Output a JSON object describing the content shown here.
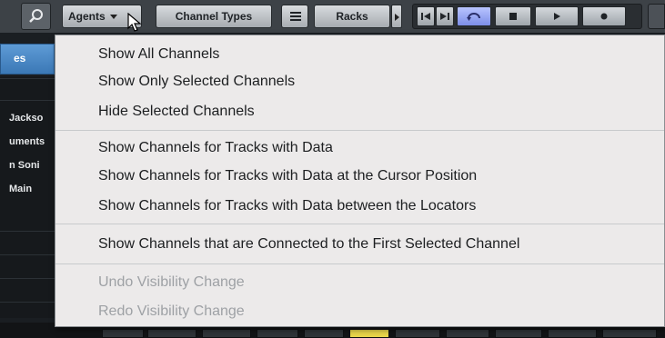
{
  "toolbar": {
    "search_icon": "search-icon",
    "agents_label": "Agents",
    "channel_types_label": "Channel Types",
    "racks_label": "Racks",
    "transport": {
      "buttons": [
        "go-to-start-icon",
        "go-to-end-icon",
        "cycle-icon",
        "stop-icon",
        "play-icon",
        "record-icon"
      ],
      "cycle_active_color": "#8a9bf0"
    }
  },
  "left_panel": {
    "tab_label": "es",
    "channels": [
      "Jackso",
      "uments",
      "n Soni",
      "Main"
    ]
  },
  "menu": {
    "groups": [
      {
        "items": [
          {
            "label": "Show All Channels",
            "enabled": true
          },
          {
            "label": "Show Only Selected Channels",
            "enabled": true
          },
          {
            "label": "Hide Selected Channels",
            "enabled": true
          }
        ]
      },
      {
        "items": [
          {
            "label": "Show Channels for Tracks with Data",
            "enabled": true
          },
          {
            "label": "Show Channels for Tracks with Data at the Cursor Position",
            "enabled": true
          },
          {
            "label": "Show Channels for Tracks with Data between the Locators",
            "enabled": true
          }
        ]
      },
      {
        "items": [
          {
            "label": "Show Channels that are Connected to the First Selected Channel",
            "enabled": true
          }
        ]
      },
      {
        "items": [
          {
            "label": "Undo Visibility Change",
            "enabled": false
          },
          {
            "label": "Redo Visibility Change",
            "enabled": false
          }
        ]
      }
    ]
  },
  "colors": {
    "toolbar_bg": "#3d4247",
    "menu_bg": "#eceaea",
    "selected_tab": "#4a88c6",
    "active_slot": "#e8d54a"
  }
}
